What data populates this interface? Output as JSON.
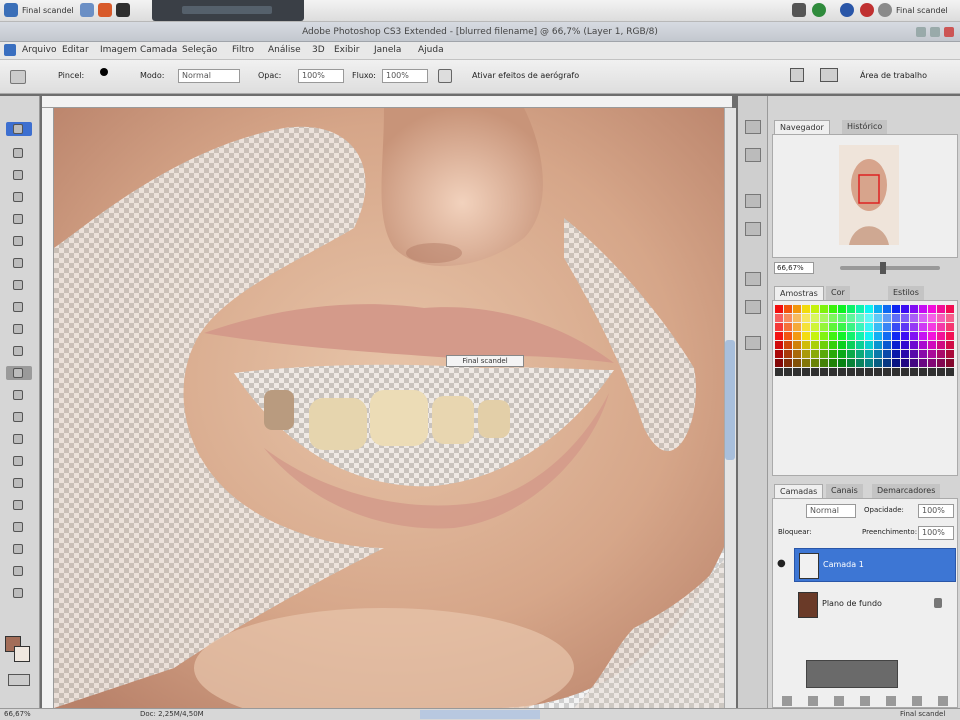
{
  "os": {
    "window_tab": "[blurred]",
    "user": "Final scandel",
    "taskbar_left": "Final scandel"
  },
  "app": {
    "title": "Adobe Photoshop CS3 Extended - [blurred filename] @ 66,7% (Layer 1, RGB/8)"
  },
  "menus": [
    "Arquivo",
    "Editar",
    "Imagem",
    "Camada",
    "Seleção",
    "Filtro",
    "Análise",
    "3D",
    "Exibir",
    "Janela",
    "Ajuda"
  ],
  "options": {
    "brush_label": "Pincel:",
    "mode_label": "Modo:",
    "mode_value": "Normal",
    "opacity_label": "Opac:",
    "opacity_value": "100%",
    "flow_label": "Fluxo:",
    "flow_value": "100%",
    "airbrush_label": "Ativar efeitos de aerógrafo",
    "workspace_label": "Área de trabalho"
  },
  "canvas": {
    "tooltip": "Final scandel"
  },
  "panels": {
    "tabs_top": [
      "Navegador",
      "Histórico"
    ],
    "zoom_value": "66,67%",
    "tabs_mid": [
      "Amostras",
      "Cor",
      "Estilos"
    ],
    "tabs_layers": [
      "Camadas",
      "Canais",
      "Demarcadores"
    ],
    "blend_mode": "Normal",
    "opacity_label": "Opacidade:",
    "opacity_value": "100%",
    "lock_label": "Bloquear:",
    "fill_label": "Preenchimento:",
    "fill_value": "100%",
    "layers": [
      {
        "name": "Camada 1",
        "selected": true
      },
      {
        "name": "Plano de fundo",
        "selected": false
      }
    ]
  },
  "status": {
    "zoom": "66,67%",
    "doc": "Doc: 2,25M/4,50M",
    "right": "Final scandel"
  },
  "colors": {
    "accent": "#3d6fd0",
    "selected_layer": "#3d76d4"
  }
}
